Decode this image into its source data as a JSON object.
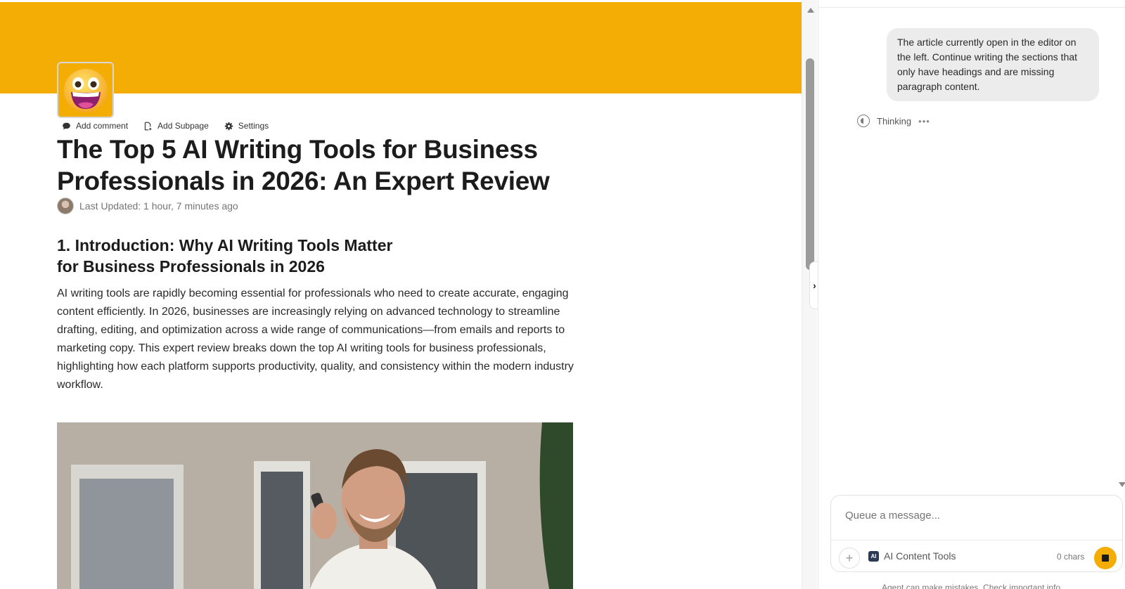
{
  "colors": {
    "cover": "#f3ad05",
    "accent": "#f3ad05"
  },
  "page": {
    "icon": "grinning-face-emoji",
    "actions": {
      "add_comment": "Add comment",
      "add_subpage": "Add Subpage",
      "settings": "Settings"
    },
    "title": "The Top 5 AI Writing Tools for Business Professionals in 2026: An Expert Review",
    "last_updated": "Last Updated: 1 hour, 7 minutes ago",
    "section_heading": "1. Introduction: Why AI Writing Tools Matter for Business Professionals in 2026",
    "section_paragraph": "AI writing tools are rapidly becoming essential for professionals who need to create accurate, engaging content efficiently. In 2026, businesses are increasingly relying on advanced technology to streamline drafting, editing, and optimization across a wide range of communications—from emails and reports to marketing copy. This expert review breaks down the top AI writing tools for business professionals, highlighting how each platform supports productivity, quality, and consistency within the modern industry workflow.",
    "image": "man-smiling-on-phone-photo"
  },
  "chat": {
    "user_message": "The article currently open in the editor on the left. Continue writing the sections that only have headings and are missing paragraph content.",
    "status": "Thinking",
    "composer": {
      "placeholder": "Queue a message...",
      "tool_label": "AI Content Tools",
      "char_count": "0 chars"
    },
    "disclaimer": "Agent can make mistakes. Check important info."
  }
}
